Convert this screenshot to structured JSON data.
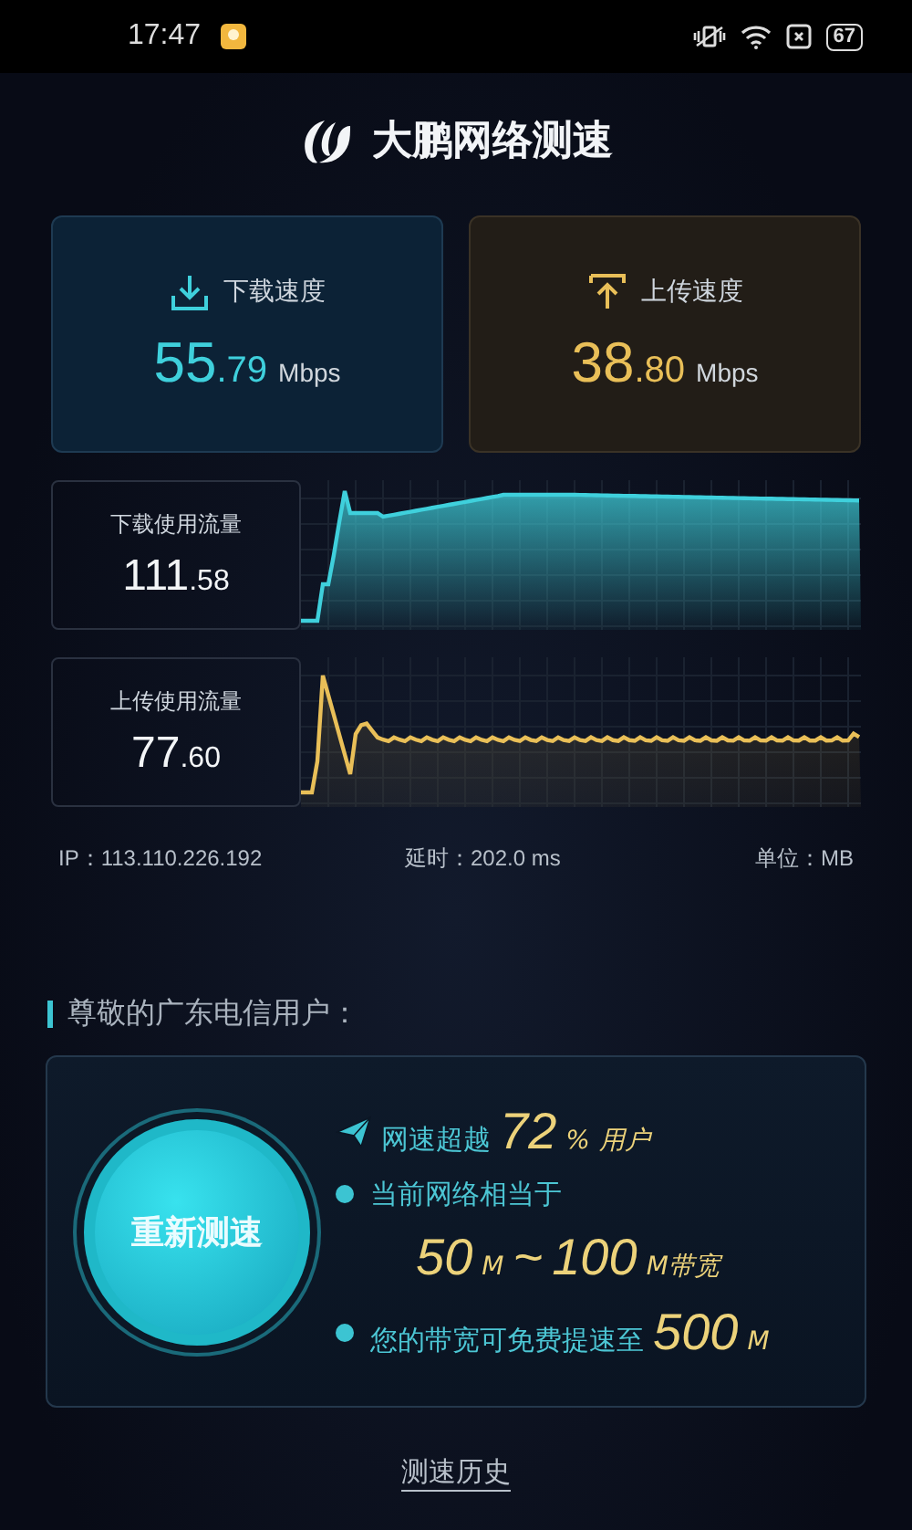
{
  "status_bar": {
    "time": "17:47",
    "battery": "67"
  },
  "header": {
    "title": "大鹏网络测速"
  },
  "speed_cards": [
    {
      "kind": "download",
      "label": "下载速度",
      "integer": "55",
      "decimal": ".79",
      "unit": "Mbps"
    },
    {
      "kind": "upload",
      "label": "上传速度",
      "integer": "38",
      "decimal": ".80",
      "unit": "Mbps"
    }
  ],
  "usage": [
    {
      "kind": "download",
      "label": "下载使用流量",
      "integer": "111",
      "decimal": ".58"
    },
    {
      "kind": "upload",
      "label": "上传使用流量",
      "integer": "77",
      "decimal": ".60"
    }
  ],
  "info": {
    "ip": "IP：113.110.226.192",
    "latency": "延时：202.0 ms",
    "unit": "单位：MB"
  },
  "greeting": "尊敬的广东电信用户：",
  "retest_button": "重新测速",
  "results": [
    {
      "kind": "plane",
      "segments": [
        {
          "kind": "label",
          "text": "网速超越"
        },
        {
          "kind": "number",
          "text": "72"
        },
        {
          "kind": "unit",
          "text": "%"
        },
        {
          "kind": "unit",
          "text": "用户"
        }
      ]
    },
    {
      "kind": "dot",
      "segments": [
        {
          "kind": "label",
          "text": "当前网络相当于"
        }
      ]
    },
    {
      "kind": "none",
      "segments": [
        {
          "kind": "number",
          "text": "50"
        },
        {
          "kind": "unit",
          "text": "M"
        },
        {
          "kind": "number",
          "text": "~"
        },
        {
          "kind": "number",
          "text": "100"
        },
        {
          "kind": "unit",
          "text": "M带宽"
        }
      ]
    },
    {
      "kind": "dot",
      "segments": [
        {
          "kind": "label",
          "text": "您的带宽可免费提速至"
        },
        {
          "kind": "number",
          "text": "500"
        },
        {
          "kind": "unit",
          "text": "M"
        }
      ]
    }
  ],
  "history_link": "测速历史"
}
